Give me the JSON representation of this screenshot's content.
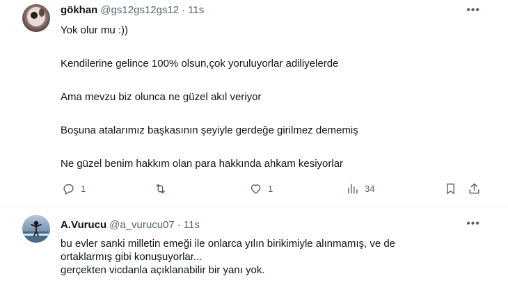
{
  "tweets": [
    {
      "author": {
        "name": "gökhan",
        "handle": "@gs12gs12gs12",
        "time": "11s"
      },
      "separator": "·",
      "more_icon": "more-horizontal-icon",
      "body": [
        "Yok olur mu :))",
        "Kendilerine gelince 100% olsun,çok yoruluyorlar adiliyelerde",
        "Ama mevzu biz olunca ne güzel akıl veriyor",
        "Boşuna atalarımız başkasının şeyiyle gerdeğe girilmez dememiş",
        "Ne güzel benim hakkım olan para hakkında ahkam kesiyorlar"
      ],
      "actions": {
        "reply_count": "1",
        "retweet_count": "",
        "like_count": "1",
        "views_count": "34"
      }
    },
    {
      "author": {
        "name": "A.Vurucu",
        "handle": "@a_vurucu07",
        "time": "11s"
      },
      "separator": "·",
      "more_icon": "more-horizontal-icon",
      "body": [
        "bu evler sanki milletin emeği ile onlarca yılın birikimiyle alınmamış, ve de",
        "ortaklarmış gibi konuşuyorlar...",
        "gerçekten vicdanla açıklanabilir bir yanı yok."
      ]
    }
  ],
  "colors": {
    "text": "#0f1419",
    "muted": "#536471",
    "divider": "#eff3f4"
  }
}
